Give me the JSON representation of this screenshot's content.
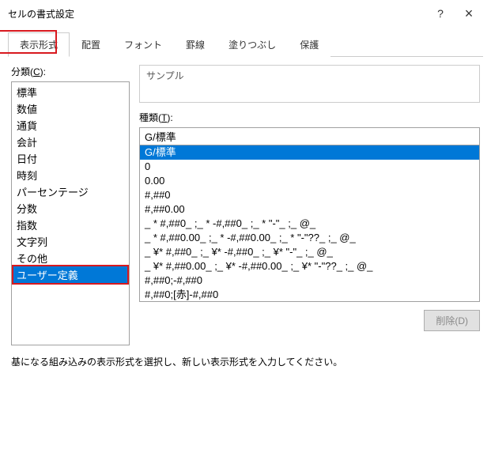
{
  "title": "セルの書式設定",
  "help_symbol": "?",
  "close_symbol": "×",
  "tabs": [
    {
      "label": "表示形式",
      "active": true
    },
    {
      "label": "配置",
      "active": false
    },
    {
      "label": "フォント",
      "active": false
    },
    {
      "label": "罫線",
      "active": false
    },
    {
      "label": "塗りつぶし",
      "active": false
    },
    {
      "label": "保護",
      "active": false
    }
  ],
  "category_label_prefix": "分類(",
  "category_label_key": "C",
  "category_label_suffix": "):",
  "categories": [
    "標準",
    "数値",
    "通貨",
    "会計",
    "日付",
    "時刻",
    "パーセンテージ",
    "分数",
    "指数",
    "文字列",
    "その他",
    "ユーザー定義"
  ],
  "selected_category_index": 11,
  "sample_label": "サンプル",
  "type_label_prefix": "種類(",
  "type_label_key": "T",
  "type_label_suffix": "):",
  "type_value": "G/標準",
  "formats": [
    "G/標準",
    "0",
    "0.00",
    "#,##0",
    "#,##0.00",
    "_ * #,##0_ ;_ * -#,##0_ ;_ * \"-\"_ ;_ @_",
    "_ * #,##0.00_ ;_ * -#,##0.00_ ;_ * \"-\"??_ ;_ @_",
    "_ ¥* #,##0_ ;_ ¥* -#,##0_ ;_ ¥* \"-\"_ ;_ @_",
    "_ ¥* #,##0.00_ ;_ ¥* -#,##0.00_ ;_ ¥* \"-\"??_ ;_ @_",
    "#,##0;-#,##0",
    "#,##0;[赤]-#,##0"
  ],
  "selected_format_index": 0,
  "delete_btn": "削除(D)",
  "footer": "基になる組み込みの表示形式を選択し、新しい表示形式を入力してください。"
}
